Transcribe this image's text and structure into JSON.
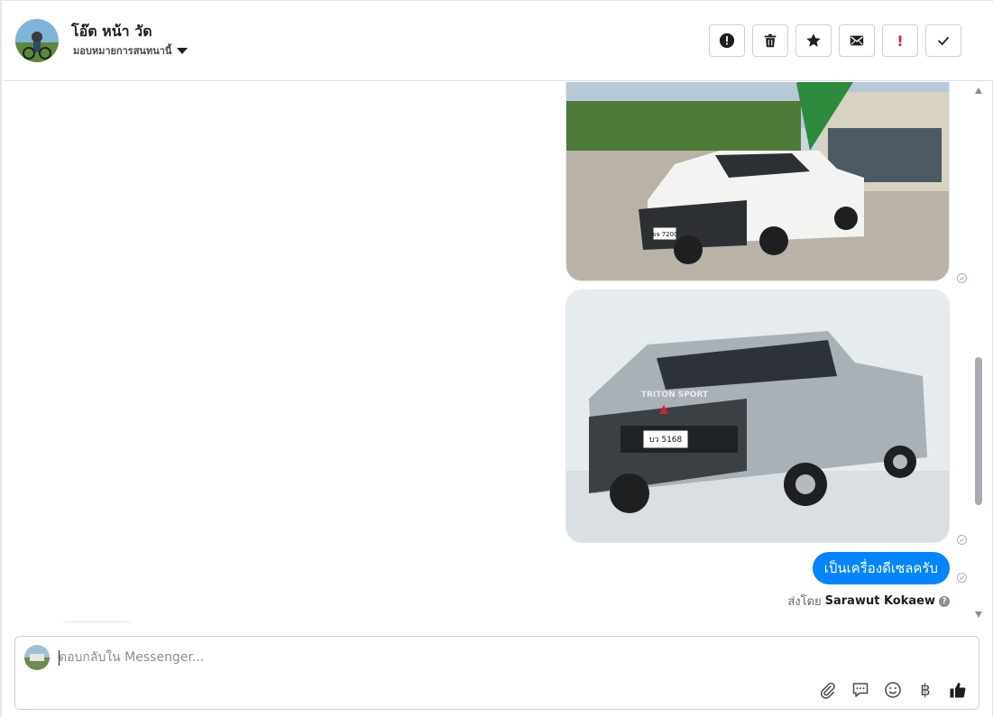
{
  "header": {
    "contact_name": "โอ๊ต หน้า วัด",
    "assign_label": "มอบหมายการสนทนานี้",
    "actions": [
      {
        "icon": "spam-icon",
        "label": "Mark as spam"
      },
      {
        "icon": "trash-icon",
        "label": "Delete"
      },
      {
        "icon": "star-icon",
        "label": "Star"
      },
      {
        "icon": "envelope-icon",
        "label": "Mark as unread"
      },
      {
        "icon": "important-icon",
        "label": "Mark important"
      },
      {
        "icon": "check-icon",
        "label": "Mark as done"
      }
    ]
  },
  "thread": {
    "message_text": "เป็นเครื่องดีเซลครับ",
    "sent_by_prefix": "ส่งโดย",
    "sent_by_name": "Sarawut Kokaew",
    "photo1_plate": "ขจ 7200",
    "photo2_brand": "TRITON SPORT",
    "photo2_plate": "บว 5168"
  },
  "composer": {
    "placeholder": "ตอบกลับใน Messenger...",
    "value": "",
    "tools": [
      "attach-icon",
      "saved-reply-icon",
      "emoji-icon",
      "payment-icon",
      "like-icon"
    ]
  },
  "colors": {
    "accent": "#0084ff",
    "bubble_text": "#ffffff",
    "important": "#e41e3f"
  }
}
